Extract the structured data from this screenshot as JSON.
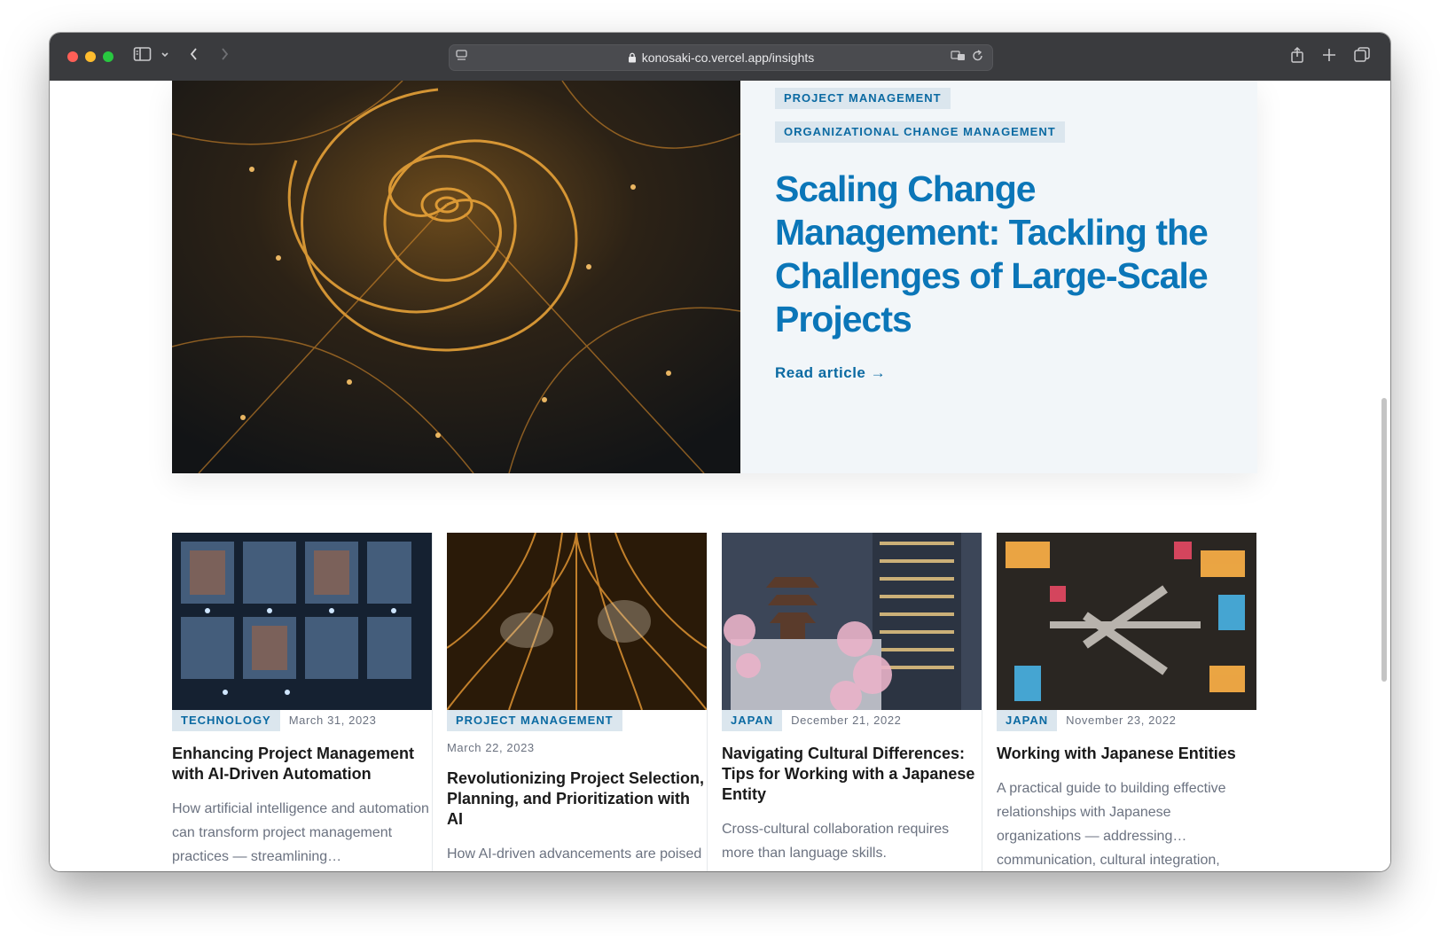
{
  "browser": {
    "url": "konosaki-co.vercel.app/insights"
  },
  "hero": {
    "tags": [
      "PROJECT MANAGEMENT",
      "ORGANIZATIONAL CHANGE MANAGEMENT"
    ],
    "title": "Scaling Change Management: Tackling the Challenges of Large-Scale Projects",
    "link": "Read article →"
  },
  "cards": [
    {
      "tag": "TECHNOLOGY",
      "date": "March 31, 2023",
      "title": "Enhancing Project Management with AI-Driven Automation",
      "excerpt": "How artificial intelligence and automation can transform project management practices — streamlining…"
    },
    {
      "tag": "PROJECT MANAGEMENT",
      "date": "March 22, 2023",
      "title": "Revolutionizing Project Selection, Planning, and Prioritization with AI",
      "excerpt": "How AI-driven advancements are poised to revolutionize project"
    },
    {
      "tag": "JAPAN",
      "date": "December 21, 2022",
      "title": "Navigating Cultural Differences: Tips for Working with a Japanese Entity",
      "excerpt": "Cross-cultural collaboration requires more than language skills."
    },
    {
      "tag": "JAPAN",
      "date": "November 23, 2022",
      "title": "Working with Japanese Entities",
      "excerpt": "A practical guide to building effective relationships with Japanese organizations — addressing… communication, cultural integration,"
    }
  ],
  "colors": {
    "accent": "#0b76b8",
    "tag_bg": "#dbe6ee",
    "hero_bg": "#f2f6f9"
  }
}
